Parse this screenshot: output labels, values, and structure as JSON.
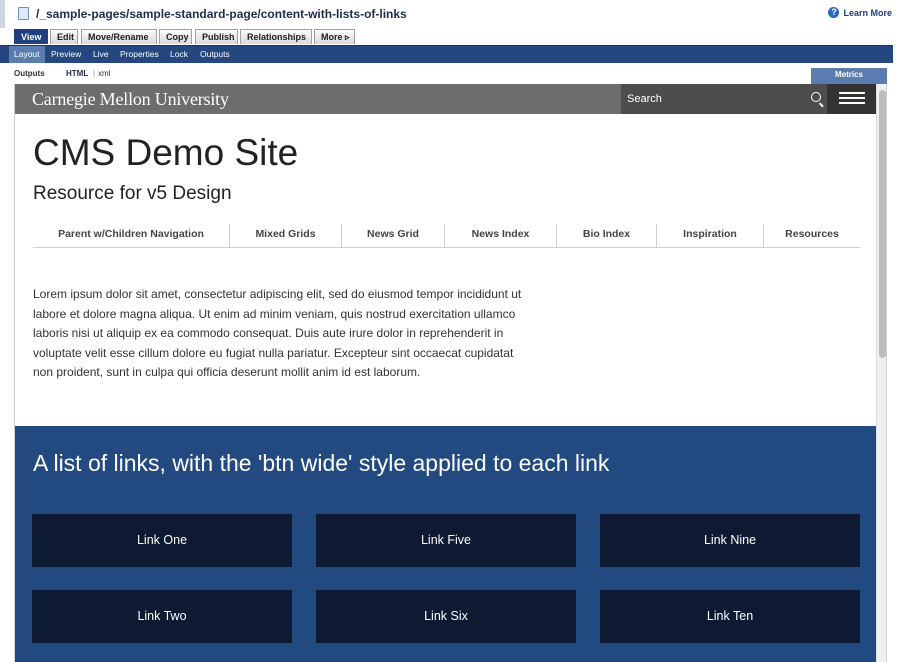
{
  "path": "/_sample-pages/sample-standard-page/content-with-lists-of-links",
  "help_label": "Learn More",
  "actions": [
    {
      "label": "View",
      "active": true
    },
    {
      "label": "Edit"
    },
    {
      "label": "Move/Rename"
    },
    {
      "label": "Copy"
    },
    {
      "label": "Publish"
    },
    {
      "label": "Relationships"
    },
    {
      "label": "More ▹"
    }
  ],
  "subtabs": [
    "Layout",
    "Preview",
    "Live",
    "Properties",
    "Lock",
    "Outputs"
  ],
  "outputs": {
    "label": "Outputs",
    "html": "HTML",
    "separator": "|",
    "xml": "xml"
  },
  "metrics_label": "Metrics",
  "site": {
    "logo": "Carnegie Mellon University",
    "search_placeholder": "Search",
    "title": "CMS Demo Site",
    "subtitle": "Resource for v5 Design",
    "nav": [
      "Parent w/Children Navigation",
      "Mixed Grids",
      "News Grid",
      "News Index",
      "Bio Index",
      "Inspiration",
      "Resources"
    ],
    "lorem": "Lorem ipsum dolor sit amet, consectetur adipiscing elit, sed do eiusmod tempor incididunt ut labore et dolore magna aliqua. Ut enim ad minim veniam, quis nostrud exercitation ullamco laboris nisi ut aliquip ex ea commodo consequat. Duis aute irure dolor in reprehenderit in voluptate velit esse cillum dolore eu fugiat nulla pariatur. Excepteur sint occaecat cupidatat non proident, sunt in culpa qui officia deserunt mollit anim id est laborum.",
    "links_heading": "A list of links, with the 'btn wide' style applied to each link",
    "links": [
      "Link One",
      "Link Five",
      "Link Nine",
      "Link Two",
      "Link Six",
      "Link Ten"
    ]
  },
  "colors": {
    "toolbar_blue": "#24477f",
    "active_tab": "#1f3f7f",
    "band_blue": "#234a80",
    "button_dark": "#0e1a31",
    "cmu_bar_gray": "#6d6d6d"
  }
}
